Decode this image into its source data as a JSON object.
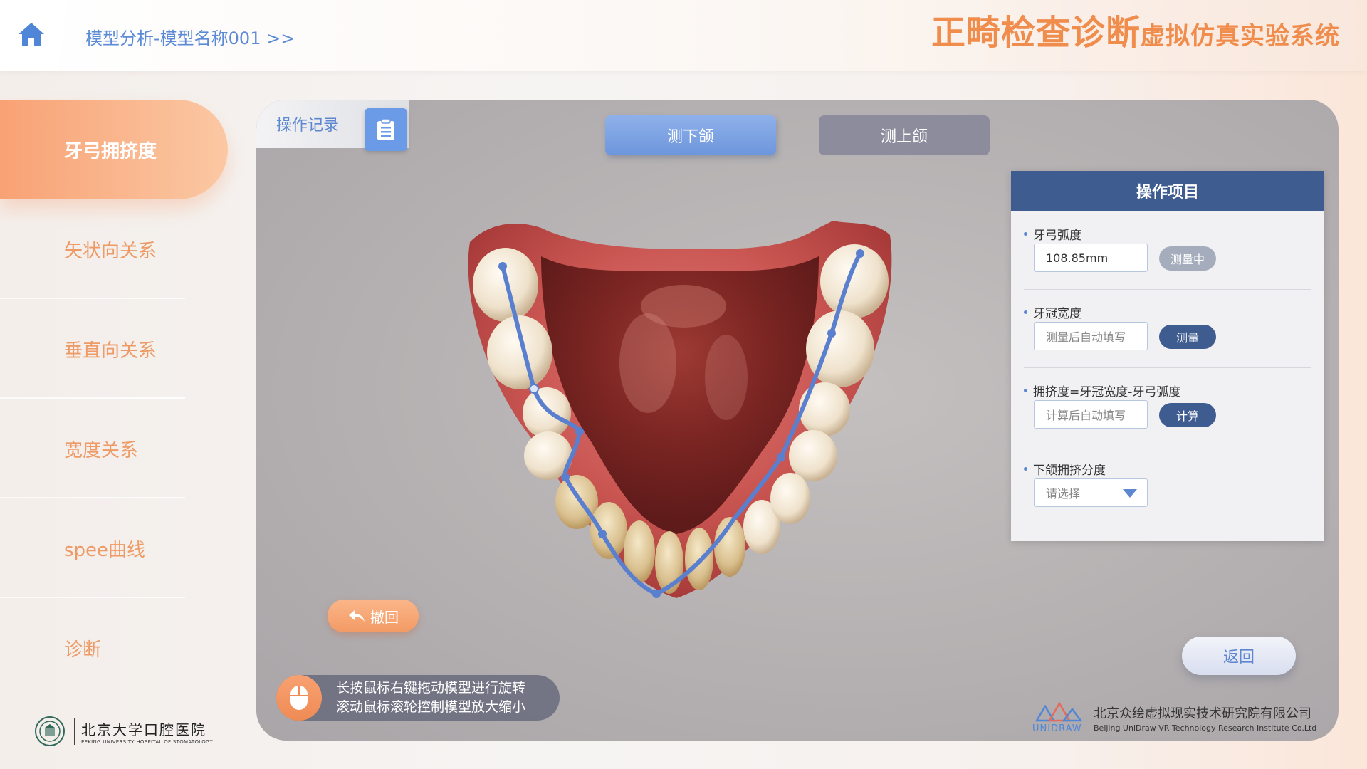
{
  "header": {
    "breadcrumb": "模型分析-模型名称001 >>",
    "title_main": "正畸检查诊断",
    "title_sub": "虚拟仿真实验系统"
  },
  "sidebar": {
    "items": [
      {
        "label": "牙弓拥挤度",
        "active": true
      },
      {
        "label": "矢状向关系",
        "active": false
      },
      {
        "label": "垂直向关系",
        "active": false
      },
      {
        "label": "宽度关系",
        "active": false
      },
      {
        "label": "spee曲线",
        "active": false
      },
      {
        "label": "诊断",
        "active": false
      }
    ],
    "logo_cn": "北京大学口腔医院",
    "logo_en": "PEKING UNIVERSITY HOSPITAL OF STOMATOLOGY"
  },
  "main": {
    "op_record_label": "操作记录",
    "tabs": [
      {
        "label": "测下颌",
        "active": true
      },
      {
        "label": "测上颌",
        "active": false
      }
    ],
    "undo_label": "撤回",
    "hint_line1": "长按鼠标右键拖动模型进行旋转",
    "hint_line2": "滚动鼠标滚轮控制模型放大缩小",
    "return_label": "返回"
  },
  "op_panel": {
    "title": "操作项目",
    "arch_length": {
      "label": "牙弓弧度",
      "value": "108.85mm",
      "button": "测量中"
    },
    "crown_width": {
      "label": "牙冠宽度",
      "placeholder": "测量后自动填写",
      "button": "测量"
    },
    "crowding": {
      "label": "拥挤度=牙冠宽度-牙弓弧度",
      "placeholder": "计算后自动填写",
      "button": "计算"
    },
    "mandible_grade": {
      "label": "下颌拥挤分度",
      "placeholder": "请选择"
    }
  },
  "company": {
    "logo_word": "UNIDRAW",
    "name_cn": "北京众绘虚拟现实技术研究院有限公司",
    "name_en": "Beijing UniDraw VR Technology Research Institute Co.Ltd"
  },
  "colors": {
    "accent_orange": "#f08d4c",
    "accent_blue": "#5d87d0",
    "panel_navy": "#3e5c90",
    "arch_line": "#5a7fcf"
  }
}
